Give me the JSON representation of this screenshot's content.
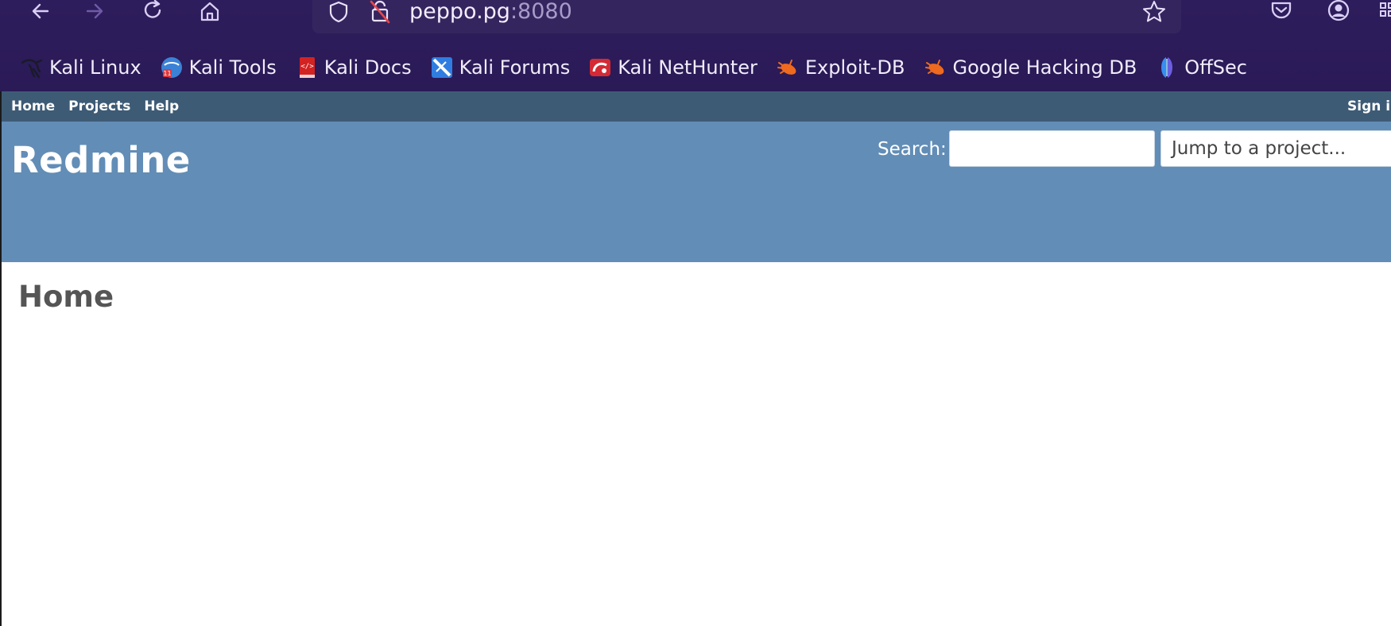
{
  "browser": {
    "url_host": "peppo.pg",
    "url_port": ":8080",
    "bookmarks": [
      {
        "label": "Kali Linux",
        "icon": "kali-dragon-icon"
      },
      {
        "label": "Kali Tools",
        "icon": "kali-tools-icon"
      },
      {
        "label": "Kali Docs",
        "icon": "kali-docs-icon"
      },
      {
        "label": "Kali Forums",
        "icon": "kali-forums-icon"
      },
      {
        "label": "Kali NetHunter",
        "icon": "kali-nethunter-icon"
      },
      {
        "label": "Exploit-DB",
        "icon": "exploit-db-icon"
      },
      {
        "label": "Google Hacking DB",
        "icon": "google-hacking-db-icon"
      },
      {
        "label": "OffSec",
        "icon": "offsec-icon"
      }
    ]
  },
  "redmine": {
    "top_menu": {
      "home": "Home",
      "projects": "Projects",
      "help": "Help",
      "sign_in": "Sign in"
    },
    "header": {
      "title": "Redmine",
      "search_label": "Search:",
      "search_value": "",
      "project_jump": "Jump to a project..."
    },
    "main": {
      "title": "Home"
    }
  }
}
